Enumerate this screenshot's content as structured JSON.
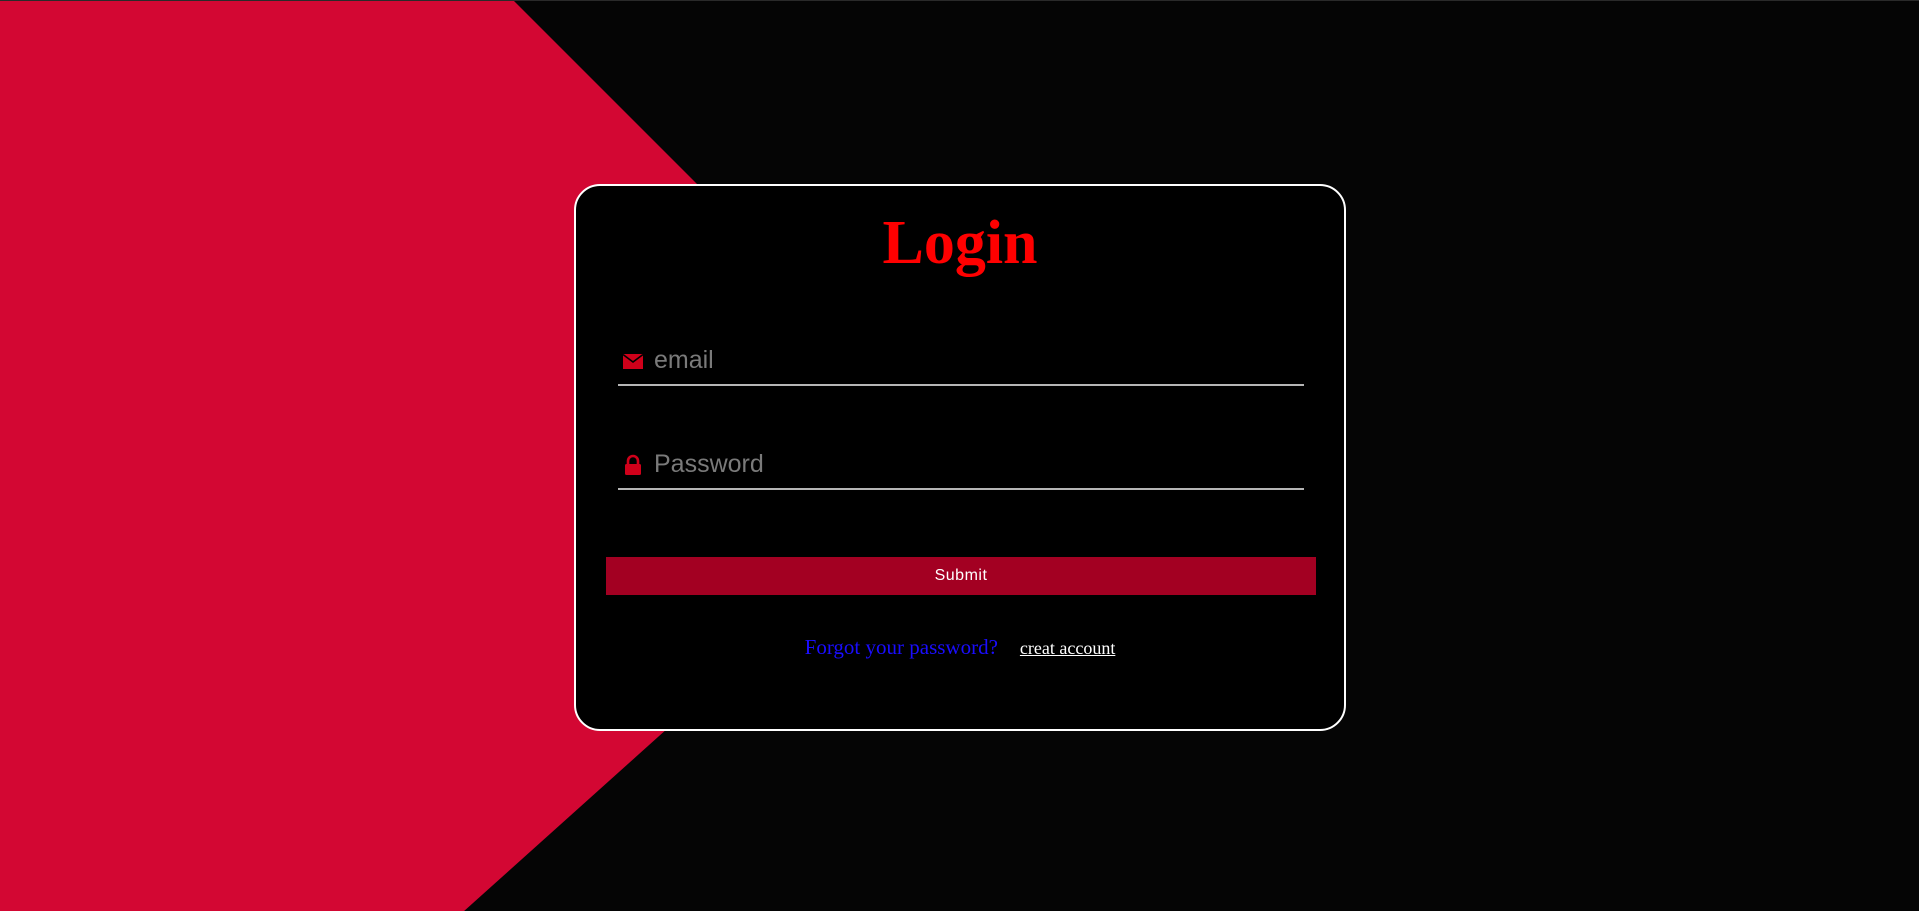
{
  "colors": {
    "background": "#050505",
    "accent_shape": "#d30733",
    "card_background": "#000000",
    "card_border": "#ffffff",
    "title": "#ff0000",
    "icon": "#d0001a",
    "submit_background": "#a30022",
    "forgot_link": "#1a0dff",
    "create_link": "#ffffff"
  },
  "login": {
    "title": "Login",
    "email": {
      "icon": "envelope-icon",
      "placeholder": "email",
      "value": ""
    },
    "password": {
      "icon": "lock-icon",
      "placeholder": "Password",
      "value": ""
    },
    "submit_label": "Submit",
    "forgot_label": "Forgot your password?",
    "create_label": "creat account"
  }
}
